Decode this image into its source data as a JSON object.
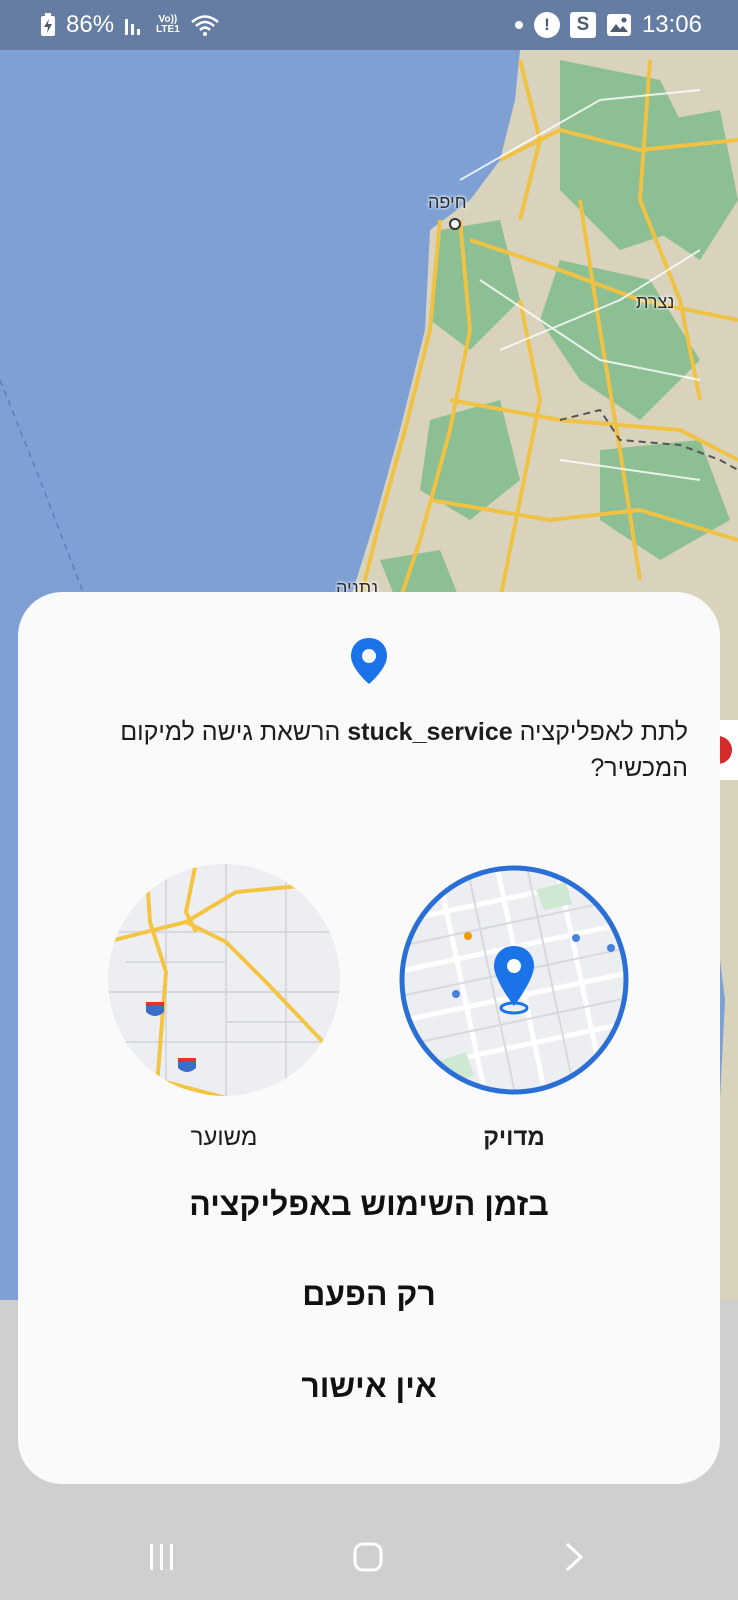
{
  "status_bar": {
    "battery": "86%",
    "network": "LTE1",
    "volte": "Vo))",
    "time": "13:06",
    "icons": [
      "battery-charging-icon",
      "signal-icon",
      "volte-icon",
      "wifi-icon",
      "dot-icon",
      "alert-icon",
      "s-app-icon",
      "gallery-icon"
    ]
  },
  "map": {
    "labels": {
      "haifa": "חיפה",
      "nazareth": "נצרת",
      "netanya": "נתניה"
    },
    "colors": {
      "sea": "#7ea0d4",
      "land": "#d9d2bd",
      "green": "#8cbf93",
      "road": "#f0c244"
    }
  },
  "dialog": {
    "icon": "location-pin-icon",
    "question_prefix": "לתת לאפליקציה",
    "app_name": "stuck_service",
    "question_suffix": "הרשאת גישה למיקום המכשיר?",
    "options": {
      "precise": "מדויק",
      "approximate": "משוער"
    },
    "selected_option": "precise",
    "actions": {
      "while_using": "בזמן השימוש באפליקציה",
      "only_this_time": "רק הפעם",
      "deny": "אין אישור"
    },
    "accent_color": "#2a6fd6"
  },
  "nav_bar": {
    "icons": [
      "recents-icon",
      "home-icon",
      "back-icon"
    ]
  }
}
